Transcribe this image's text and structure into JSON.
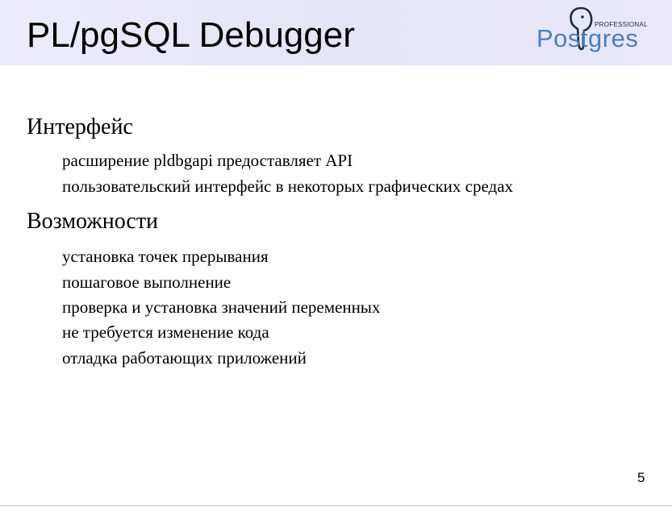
{
  "slide": {
    "title": "PL/pgSQL Debugger",
    "logo": {
      "word": "Postgres",
      "badge": "PROFESSIONAL",
      "color": "#4a7fc1"
    },
    "sections": [
      {
        "heading": "Интерфейс",
        "items": [
          "расширение pldbgapi предоставляет API",
          "пользовательский интерфейс в некоторых графических средах"
        ]
      },
      {
        "heading": "Возможности",
        "items": [
          "установка точек прерывания",
          "пошаговое выполнение",
          "проверка и установка значений переменных",
          "не требуется изменение кода",
          "отладка работающих приложений"
        ]
      }
    ],
    "page_number": "5"
  }
}
